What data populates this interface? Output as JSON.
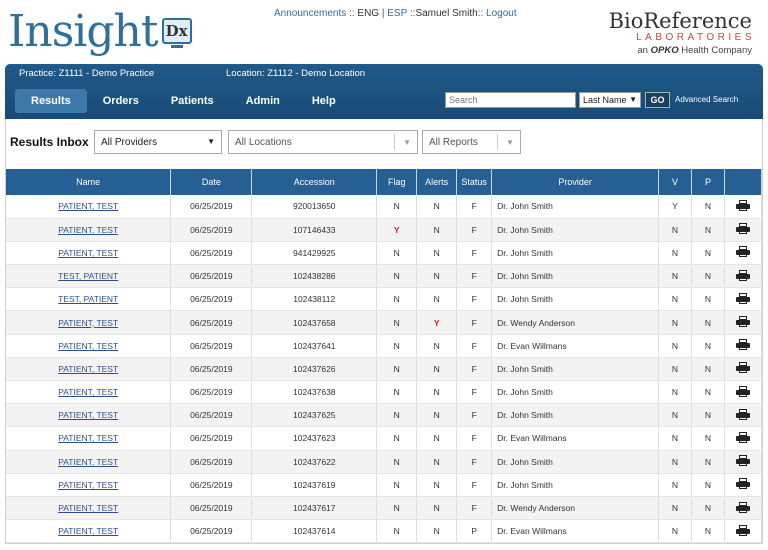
{
  "header": {
    "logo": {
      "text": "Insight",
      "badge": "Dx"
    },
    "links": {
      "announcements": "Announcements",
      "sep1": "::",
      "eng": "ENG",
      "pipe": "|",
      "esp": "ESP",
      "sep2": "::",
      "user": "Samuel Smith",
      "sep3": "::",
      "logout": "Logout"
    },
    "brand": {
      "line1": "BioReference",
      "line2": "LABORATORIES",
      "line3_prefix": "an",
      "line3_opko": "OPKO",
      "line3_suffix": "Health Company"
    }
  },
  "context": {
    "practice": "Practice:  Z1111 - Demo Practice",
    "location": "Location:  Z1112 - Demo Location"
  },
  "nav": {
    "items": [
      "Results",
      "Orders",
      "Patients",
      "Admin",
      "Help"
    ],
    "search_placeholder": "Search",
    "search_type": "Last Name",
    "go": "GO",
    "advanced": "Advanced Search"
  },
  "inbox": {
    "title": "Results Inbox",
    "providers": "All Providers",
    "locations": "All Locations",
    "reports": "All Reports"
  },
  "table": {
    "columns": [
      "Name",
      "Date",
      "Accession",
      "Flag",
      "Alerts",
      "Status",
      "Provider",
      "V",
      "P"
    ],
    "rows": [
      {
        "name": "PATIENT, TEST",
        "date": "06/25/2019",
        "acc": "920013650",
        "flag": "N",
        "alerts": "N",
        "status": "F",
        "provider": "Dr. John Smith",
        "v": "Y",
        "p": "N"
      },
      {
        "name": "PATIENT, TEST",
        "date": "06/25/2019",
        "acc": "107146433",
        "flag": "Y",
        "alerts": "N",
        "status": "F",
        "provider": "Dr. John Smith",
        "v": "N",
        "p": "N"
      },
      {
        "name": "PATIENT, TEST",
        "date": "06/25/2019",
        "acc": "941429925",
        "flag": "N",
        "alerts": "N",
        "status": "F",
        "provider": "Dr. John Smith",
        "v": "N",
        "p": "N"
      },
      {
        "name": "TEST, PATIENT",
        "date": "06/25/2019",
        "acc": "102438286",
        "flag": "N",
        "alerts": "N",
        "status": "F",
        "provider": "Dr. John Smith",
        "v": "N",
        "p": "N"
      },
      {
        "name": "TEST, PATIENT",
        "date": "06/25/2019",
        "acc": "102438112",
        "flag": "N",
        "alerts": "N",
        "status": "F",
        "provider": "Dr. John Smith",
        "v": "N",
        "p": "N"
      },
      {
        "name": "PATIENT, TEST",
        "date": "06/25/2019",
        "acc": "102437658",
        "flag": "N",
        "alerts": "Y",
        "status": "F",
        "provider": "Dr. Wendy Anderson",
        "v": "N",
        "p": "N"
      },
      {
        "name": "PATIENT, TEST",
        "date": "06/25/2019",
        "acc": "102437641",
        "flag": "N",
        "alerts": "N",
        "status": "F",
        "provider": "Dr. Evan Willmans",
        "v": "N",
        "p": "N"
      },
      {
        "name": "PATIENT, TEST",
        "date": "06/25/2019",
        "acc": "102437626",
        "flag": "N",
        "alerts": "N",
        "status": "F",
        "provider": "Dr. John Smith",
        "v": "N",
        "p": "N"
      },
      {
        "name": "PATIENT, TEST",
        "date": "06/25/2019",
        "acc": "102437638",
        "flag": "N",
        "alerts": "N",
        "status": "F",
        "provider": "Dr. John Smith",
        "v": "N",
        "p": "N"
      },
      {
        "name": "PATIENT, TEST",
        "date": "06/25/2019",
        "acc": "102437625",
        "flag": "N",
        "alerts": "N",
        "status": "F",
        "provider": "Dr. John Smith",
        "v": "N",
        "p": "N"
      },
      {
        "name": "PATIENT, TEST",
        "date": "06/25/2019",
        "acc": "102437623",
        "flag": "N",
        "alerts": "N",
        "status": "F",
        "provider": "Dr. Evan Willmans",
        "v": "N",
        "p": "N"
      },
      {
        "name": "PATIENT, TEST",
        "date": "06/25/2019",
        "acc": "102437622",
        "flag": "N",
        "alerts": "N",
        "status": "F",
        "provider": "Dr. John Smith",
        "v": "N",
        "p": "N"
      },
      {
        "name": "PATIENT, TEST",
        "date": "06/25/2019",
        "acc": "102437619",
        "flag": "N",
        "alerts": "N",
        "status": "F",
        "provider": "Dr. John Smith",
        "v": "N",
        "p": "N"
      },
      {
        "name": "PATIENT, TEST",
        "date": "06/25/2019",
        "acc": "102437617",
        "flag": "N",
        "alerts": "N",
        "status": "F",
        "provider": "Dr. Wendy Anderson",
        "v": "N",
        "p": "N"
      },
      {
        "name": "PATIENT, TEST",
        "date": "06/25/2019",
        "acc": "102437614",
        "flag": "N",
        "alerts": "N",
        "status": "P",
        "provider": "Dr. Evan Willmans",
        "v": "N",
        "p": "N"
      }
    ]
  },
  "colors": {
    "accent": "#255f93",
    "flag_red": "#d21f1f",
    "link": "#2f6f9a"
  },
  "icons": {
    "print": "printer-icon"
  }
}
